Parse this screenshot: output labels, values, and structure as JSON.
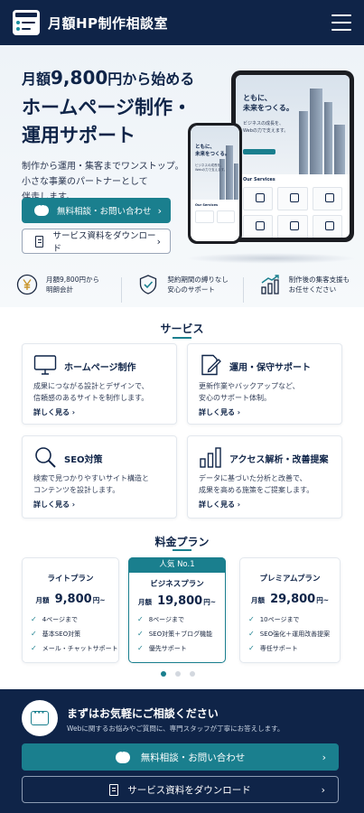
{
  "header": {
    "brand": "月額HP制作相談室",
    "logo_icon": "site-logo-icon",
    "menu_icon": "hamburger-menu-icon"
  },
  "hero": {
    "sub_prefix": "月額",
    "sub_price": "9,800",
    "sub_suffix": "円から始める",
    "title_line1": "ホームページ制作・",
    "title_line2": "運用サポート",
    "desc_line1": "制作から運用・集客までワンストップ。",
    "desc_line2": "小さな事業のパートナーとして",
    "desc_line3": "伴走します。",
    "primary_cta": "無料相談・お問い合わせ",
    "secondary_cta": "サービス資料をダウンロード",
    "mock": {
      "tablet_heading_1": "ともに、",
      "tablet_heading_2": "未来をつくる。",
      "tablet_text_1": "ビジネスの成長を、",
      "tablet_text_2": "Webの力で支えます。",
      "tablet_services": "Our Services",
      "phone_heading_1": "ともに、",
      "phone_heading_2": "未来をつくる。",
      "phone_text_1": "ビジネスの成長を、",
      "phone_text_2": "Webの力で支えます。",
      "phone_services": "Our Services"
    }
  },
  "features": [
    {
      "line1": "月額9,800円から",
      "line2": "明朗会計",
      "icon": "yen-icon"
    },
    {
      "line1": "契約期間の縛りなし",
      "line2": "安心のサポート",
      "icon": "shield-check-icon"
    },
    {
      "line1": "制作後の集客支援も",
      "line2": "お任せください",
      "icon": "growth-chart-icon"
    }
  ],
  "services": {
    "title": "サービス",
    "items": [
      {
        "title": "ホームページ制作",
        "desc1": "成果につながる設計とデザインで、",
        "desc2": "信頼感のあるサイトを制作します。",
        "more": "詳しく見る",
        "icon": "monitor-icon"
      },
      {
        "title": "運用・保守サポート",
        "desc1": "更新作業やバックアップなど、",
        "desc2": "安心のサポート体制。",
        "more": "詳しく見る",
        "icon": "edit-document-icon"
      },
      {
        "title": "SEO対策",
        "desc1": "検索で見つかりやすいサイト構造と",
        "desc2": "コンテンツを設計します。",
        "more": "詳しく見る",
        "icon": "search-icon"
      },
      {
        "title": "アクセス解析・改善提案",
        "desc1": "データに基づいた分析と改善で、",
        "desc2": "成果を高める施策をご提案します。",
        "more": "詳しく見る",
        "icon": "bar-chart-icon"
      }
    ]
  },
  "pricing": {
    "title": "料金プラン",
    "plans": [
      {
        "name": "ライトプラン",
        "prefix": "月額",
        "price": "9,800",
        "suffix": "円~",
        "features": [
          "4ページまで",
          "基本SEO対策",
          "メール・チャットサポート"
        ]
      },
      {
        "badge": "人気 No.1",
        "name": "ビジネスプラン",
        "prefix": "月額",
        "price": "19,800",
        "suffix": "円~",
        "features": [
          "8ページまで",
          "SEO対策＋ブログ機能",
          "優先サポート"
        ]
      },
      {
        "name": "プレミアムプラン",
        "prefix": "月額",
        "price": "29,800",
        "suffix": "円~",
        "features": [
          "10ページまで",
          "SEO強化＋運用改善提案",
          "専任サポート"
        ]
      }
    ],
    "carousel_page": 1,
    "carousel_total": 3
  },
  "contact": {
    "title": "まずはお気軽にご相談ください",
    "desc": "Webに関するお悩みやご質問に、専門スタッフが丁寧にお答えします。",
    "primary_cta": "無料相談・お問い合わせ",
    "secondary_cta": "サービス資料をダウンロード"
  },
  "colors": {
    "navy": "#0f2448",
    "teal": "#1a7f8e"
  }
}
